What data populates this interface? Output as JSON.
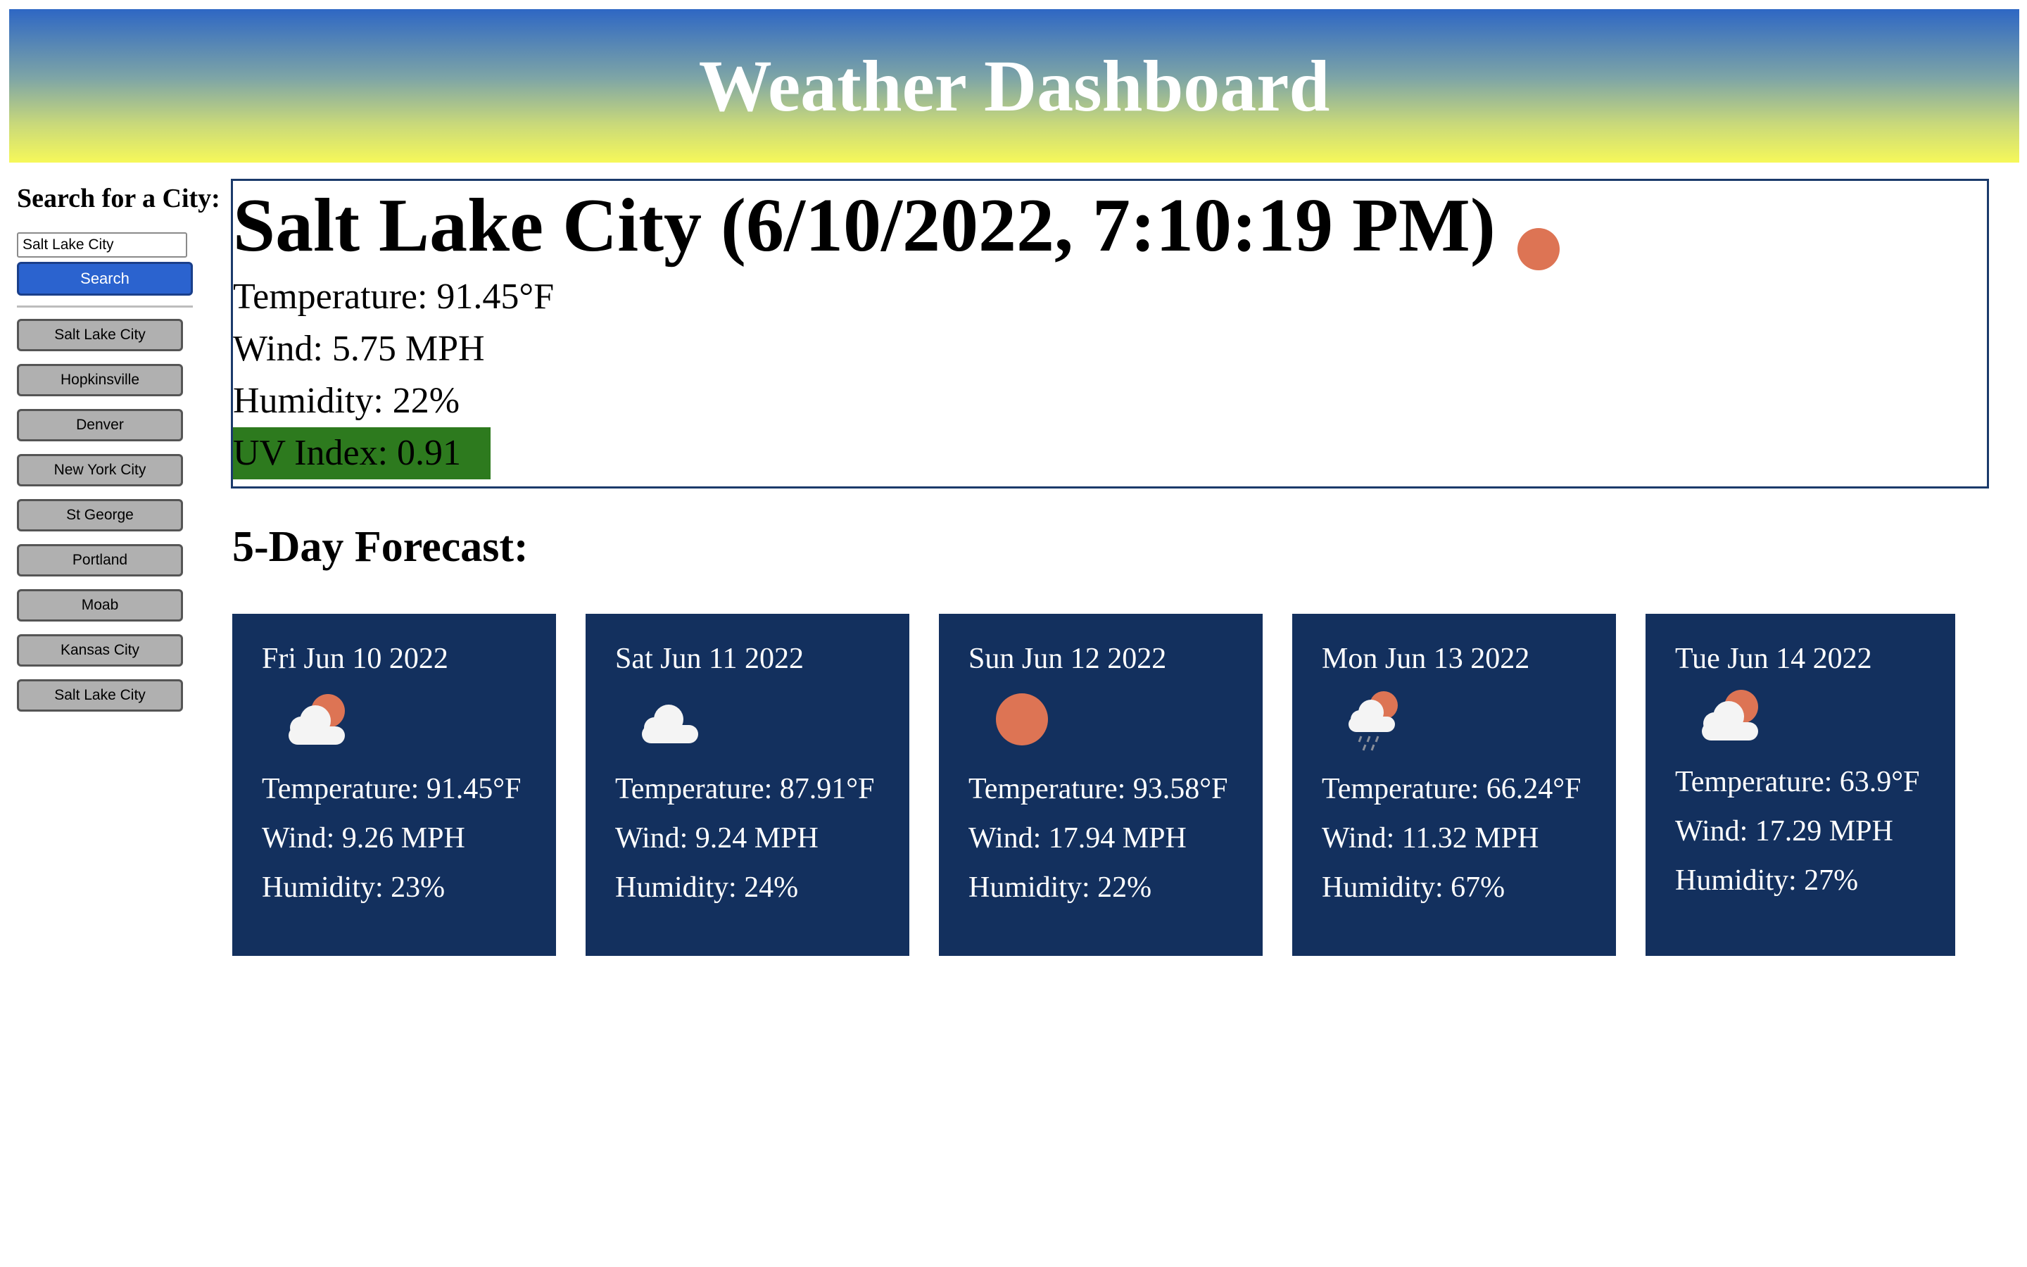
{
  "header": {
    "title": "Weather Dashboard"
  },
  "sidebar": {
    "search_label": "Search for a City:",
    "search_value": "Salt Lake City",
    "search_button": "Search",
    "history": [
      "Salt Lake City",
      "Hopkinsville",
      "Denver",
      "New York City",
      "St George",
      "Portland",
      "Moab",
      "Kansas City",
      "Salt Lake City"
    ]
  },
  "current": {
    "title": "Salt Lake City (6/10/2022, 7:10:19 PM)",
    "icon": "sun-icon",
    "temperature": "Temperature: 91.45°F",
    "wind": "Wind: 5.75 MPH",
    "humidity": "Humidity: 22%",
    "uv": "UV Index: 0.91"
  },
  "forecast": {
    "title": "5-Day Forecast:",
    "days": [
      {
        "date": "Fri Jun 10 2022",
        "icon": "partly-cloudy-icon",
        "temperature": "Temperature: 91.45°F",
        "wind": "Wind: 9.26 MPH",
        "humidity": "Humidity: 23%"
      },
      {
        "date": "Sat Jun 11 2022",
        "icon": "cloud-icon",
        "temperature": "Temperature: 87.91°F",
        "wind": "Wind: 9.24 MPH",
        "humidity": "Humidity: 24%"
      },
      {
        "date": "Sun Jun 12 2022",
        "icon": "sun-icon",
        "temperature": "Temperature: 93.58°F",
        "wind": "Wind: 17.94 MPH",
        "humidity": "Humidity: 22%"
      },
      {
        "date": "Mon Jun 13 2022",
        "icon": "rain-sun-icon",
        "temperature": "Temperature: 66.24°F",
        "wind": "Wind: 11.32 MPH",
        "humidity": "Humidity: 67%"
      },
      {
        "date": "Tue Jun 14 2022",
        "icon": "partly-cloudy-icon",
        "temperature": "Temperature: 63.9°F",
        "wind": "Wind: 17.29 MPH",
        "humidity": "Humidity: 27%"
      }
    ]
  },
  "colors": {
    "header_top": "#2e67c4",
    "header_bottom": "#f6f85a",
    "card_bg": "#13305e",
    "search_button": "#2b63cf",
    "uv_good": "#2d7a1e",
    "sun": "#dd7454"
  }
}
